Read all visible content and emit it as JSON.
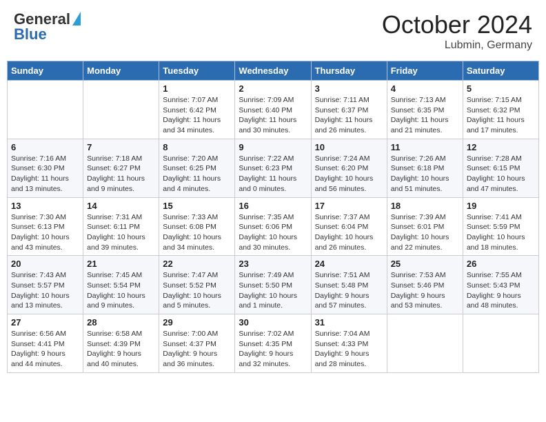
{
  "header": {
    "logo_general": "General",
    "logo_blue": "Blue",
    "month": "October 2024",
    "location": "Lubmin, Germany"
  },
  "days_of_week": [
    "Sunday",
    "Monday",
    "Tuesday",
    "Wednesday",
    "Thursday",
    "Friday",
    "Saturday"
  ],
  "weeks": [
    [
      {
        "day": "",
        "info": ""
      },
      {
        "day": "",
        "info": ""
      },
      {
        "day": "1",
        "info": "Sunrise: 7:07 AM\nSunset: 6:42 PM\nDaylight: 11 hours and 34 minutes."
      },
      {
        "day": "2",
        "info": "Sunrise: 7:09 AM\nSunset: 6:40 PM\nDaylight: 11 hours and 30 minutes."
      },
      {
        "day": "3",
        "info": "Sunrise: 7:11 AM\nSunset: 6:37 PM\nDaylight: 11 hours and 26 minutes."
      },
      {
        "day": "4",
        "info": "Sunrise: 7:13 AM\nSunset: 6:35 PM\nDaylight: 11 hours and 21 minutes."
      },
      {
        "day": "5",
        "info": "Sunrise: 7:15 AM\nSunset: 6:32 PM\nDaylight: 11 hours and 17 minutes."
      }
    ],
    [
      {
        "day": "6",
        "info": "Sunrise: 7:16 AM\nSunset: 6:30 PM\nDaylight: 11 hours and 13 minutes."
      },
      {
        "day": "7",
        "info": "Sunrise: 7:18 AM\nSunset: 6:27 PM\nDaylight: 11 hours and 9 minutes."
      },
      {
        "day": "8",
        "info": "Sunrise: 7:20 AM\nSunset: 6:25 PM\nDaylight: 11 hours and 4 minutes."
      },
      {
        "day": "9",
        "info": "Sunrise: 7:22 AM\nSunset: 6:23 PM\nDaylight: 11 hours and 0 minutes."
      },
      {
        "day": "10",
        "info": "Sunrise: 7:24 AM\nSunset: 6:20 PM\nDaylight: 10 hours and 56 minutes."
      },
      {
        "day": "11",
        "info": "Sunrise: 7:26 AM\nSunset: 6:18 PM\nDaylight: 10 hours and 51 minutes."
      },
      {
        "day": "12",
        "info": "Sunrise: 7:28 AM\nSunset: 6:15 PM\nDaylight: 10 hours and 47 minutes."
      }
    ],
    [
      {
        "day": "13",
        "info": "Sunrise: 7:30 AM\nSunset: 6:13 PM\nDaylight: 10 hours and 43 minutes."
      },
      {
        "day": "14",
        "info": "Sunrise: 7:31 AM\nSunset: 6:11 PM\nDaylight: 10 hours and 39 minutes."
      },
      {
        "day": "15",
        "info": "Sunrise: 7:33 AM\nSunset: 6:08 PM\nDaylight: 10 hours and 34 minutes."
      },
      {
        "day": "16",
        "info": "Sunrise: 7:35 AM\nSunset: 6:06 PM\nDaylight: 10 hours and 30 minutes."
      },
      {
        "day": "17",
        "info": "Sunrise: 7:37 AM\nSunset: 6:04 PM\nDaylight: 10 hours and 26 minutes."
      },
      {
        "day": "18",
        "info": "Sunrise: 7:39 AM\nSunset: 6:01 PM\nDaylight: 10 hours and 22 minutes."
      },
      {
        "day": "19",
        "info": "Sunrise: 7:41 AM\nSunset: 5:59 PM\nDaylight: 10 hours and 18 minutes."
      }
    ],
    [
      {
        "day": "20",
        "info": "Sunrise: 7:43 AM\nSunset: 5:57 PM\nDaylight: 10 hours and 13 minutes."
      },
      {
        "day": "21",
        "info": "Sunrise: 7:45 AM\nSunset: 5:54 PM\nDaylight: 10 hours and 9 minutes."
      },
      {
        "day": "22",
        "info": "Sunrise: 7:47 AM\nSunset: 5:52 PM\nDaylight: 10 hours and 5 minutes."
      },
      {
        "day": "23",
        "info": "Sunrise: 7:49 AM\nSunset: 5:50 PM\nDaylight: 10 hours and 1 minute."
      },
      {
        "day": "24",
        "info": "Sunrise: 7:51 AM\nSunset: 5:48 PM\nDaylight: 9 hours and 57 minutes."
      },
      {
        "day": "25",
        "info": "Sunrise: 7:53 AM\nSunset: 5:46 PM\nDaylight: 9 hours and 53 minutes."
      },
      {
        "day": "26",
        "info": "Sunrise: 7:55 AM\nSunset: 5:43 PM\nDaylight: 9 hours and 48 minutes."
      }
    ],
    [
      {
        "day": "27",
        "info": "Sunrise: 6:56 AM\nSunset: 4:41 PM\nDaylight: 9 hours and 44 minutes."
      },
      {
        "day": "28",
        "info": "Sunrise: 6:58 AM\nSunset: 4:39 PM\nDaylight: 9 hours and 40 minutes."
      },
      {
        "day": "29",
        "info": "Sunrise: 7:00 AM\nSunset: 4:37 PM\nDaylight: 9 hours and 36 minutes."
      },
      {
        "day": "30",
        "info": "Sunrise: 7:02 AM\nSunset: 4:35 PM\nDaylight: 9 hours and 32 minutes."
      },
      {
        "day": "31",
        "info": "Sunrise: 7:04 AM\nSunset: 4:33 PM\nDaylight: 9 hours and 28 minutes."
      },
      {
        "day": "",
        "info": ""
      },
      {
        "day": "",
        "info": ""
      }
    ]
  ]
}
